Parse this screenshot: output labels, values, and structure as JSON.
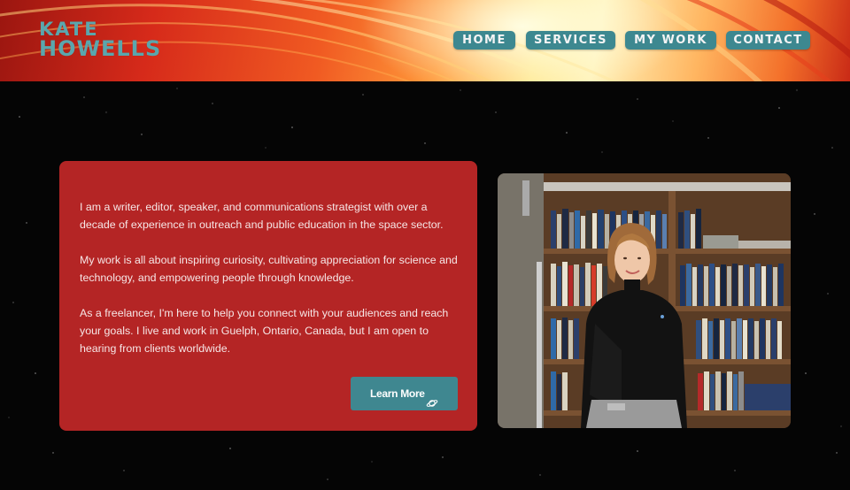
{
  "brand": {
    "name_line1": "KATE",
    "name_line2": "HOWELLS",
    "color": "#5aa6ad"
  },
  "nav": {
    "items": [
      {
        "label": "HOME"
      },
      {
        "label": "SERVICES"
      },
      {
        "label": "MY WORK"
      },
      {
        "label": "CONTACT"
      }
    ],
    "button_color": "#3d8890"
  },
  "intro": {
    "paragraph1": "I am a writer, editor, speaker, and communications strategist with over a decade of experience in outreach and public education in the space sector.",
    "paragraph2": "My work is all about inspiring curiosity, cultivating appreciation for science and technology, and empowering people through knowledge.",
    "paragraph3": "As a freelancer, I'm here to help you connect with your audiences and reach your goals. I live and work in Guelph, Ontario, Canada, but I am open to hearing from clients worldwide.",
    "card_color": "#b42525",
    "cta_label": "Learn More",
    "cta_icon": "planet-icon"
  },
  "portrait": {
    "subject": "photo-of-person-in-front-of-bookshelf"
  }
}
